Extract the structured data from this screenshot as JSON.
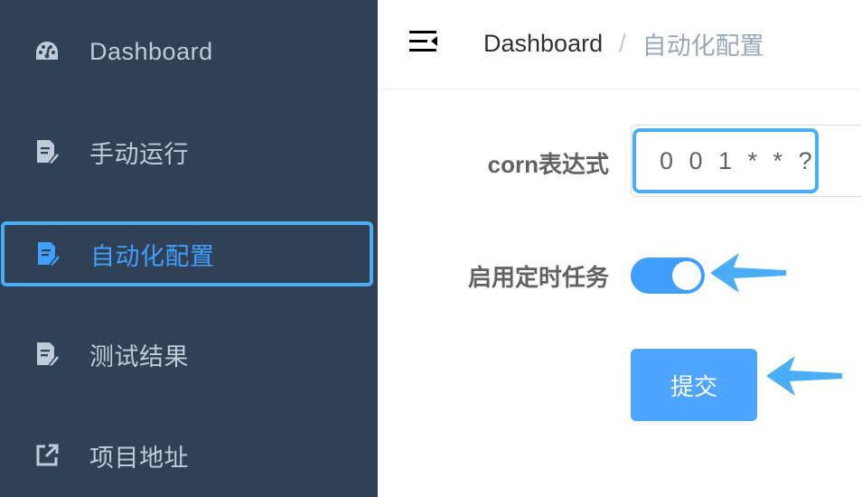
{
  "sidebar": {
    "items": [
      {
        "label": "Dashboard",
        "icon": "dashboard-icon",
        "active": false
      },
      {
        "label": "手动运行",
        "icon": "document-edit-icon",
        "active": false
      },
      {
        "label": "自动化配置",
        "icon": "document-edit-icon",
        "active": true
      },
      {
        "label": "测试结果",
        "icon": "document-edit-icon",
        "active": false
      },
      {
        "label": "项目地址",
        "icon": "external-link-icon",
        "active": false
      }
    ]
  },
  "header": {
    "breadcrumb": {
      "home": "Dashboard",
      "separator": "/",
      "current": "自动化配置"
    }
  },
  "form": {
    "cron_label": "corn表达式",
    "cron_value": "0 0 1 * * ?",
    "schedule_label": "启用定时任务",
    "schedule_enabled": true,
    "submit_label": "提交"
  },
  "colors": {
    "sidebar_bg": "#304156",
    "sidebar_text": "#bfcbd9",
    "accent": "#409eff",
    "highlight_annotation": "#4aaef7"
  }
}
